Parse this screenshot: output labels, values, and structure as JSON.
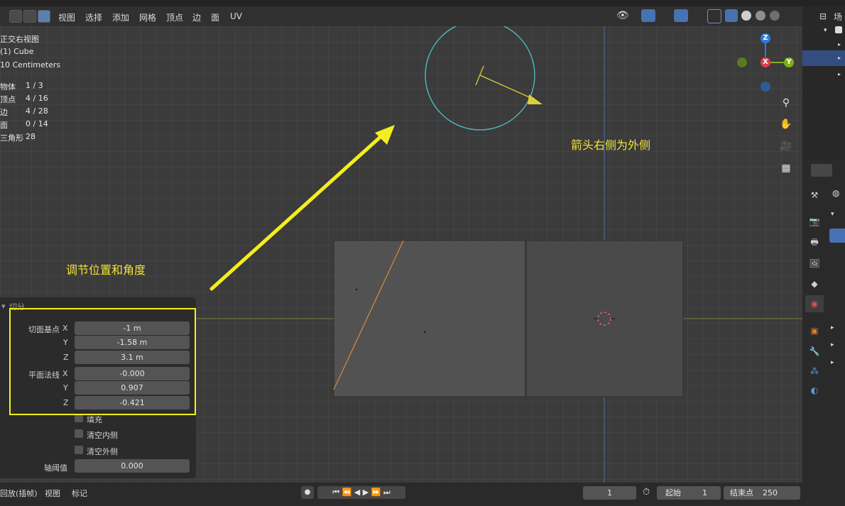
{
  "header": {
    "menu": [
      "视图",
      "选择",
      "添加",
      "网格",
      "顶点",
      "边",
      "面",
      "UV"
    ]
  },
  "viewport_info": {
    "view_name": "正交右视图",
    "object": "(1) Cube",
    "scale": "10 Centimeters",
    "stats": [
      {
        "label": "物体",
        "value": "1 / 3"
      },
      {
        "label": "顶点",
        "value": "4 / 16"
      },
      {
        "label": "边",
        "value": "4 / 28"
      },
      {
        "label": "面",
        "value": "0 / 14"
      },
      {
        "label": "三角形",
        "value": "28"
      }
    ]
  },
  "annotations": {
    "arrow_note": "箭头右侧为外侧",
    "adjust_note": "调节位置和角度"
  },
  "operator_panel": {
    "title": "切分",
    "plane_point_label": "切面基点",
    "plane_point": {
      "x": "-1 m",
      "y": "-1.58 m",
      "z": "3.1 m"
    },
    "plane_normal_label": "平面法线",
    "plane_normal": {
      "x": "-0.000",
      "y": "0.907",
      "z": "-0.421"
    },
    "axis_x": "X",
    "axis_y": "Y",
    "axis_z": "Z",
    "fill_label": "填充",
    "clear_inner_label": "清空内侧",
    "clear_outer_label": "清空外侧",
    "threshold_label": "轴阈值",
    "threshold_value": "0.000"
  },
  "gizmo": {
    "x": "X",
    "y": "Y",
    "z": "Z"
  },
  "timeline": {
    "playback": "回放(插帧)",
    "view": "视图",
    "marker": "标记",
    "current_frame": "1",
    "start_label": "起始",
    "start": "1",
    "end_label": "结束点",
    "end": "250"
  },
  "outliner": {
    "header": "场"
  },
  "colors": {
    "annotation": "#f2e33a",
    "cut_circle": "#4fc3c3",
    "cut_line": "#d98a3a"
  },
  "icons": [
    "zoom-icon",
    "hand-icon",
    "camera-icon",
    "grid-icon",
    "cursor-icon"
  ]
}
